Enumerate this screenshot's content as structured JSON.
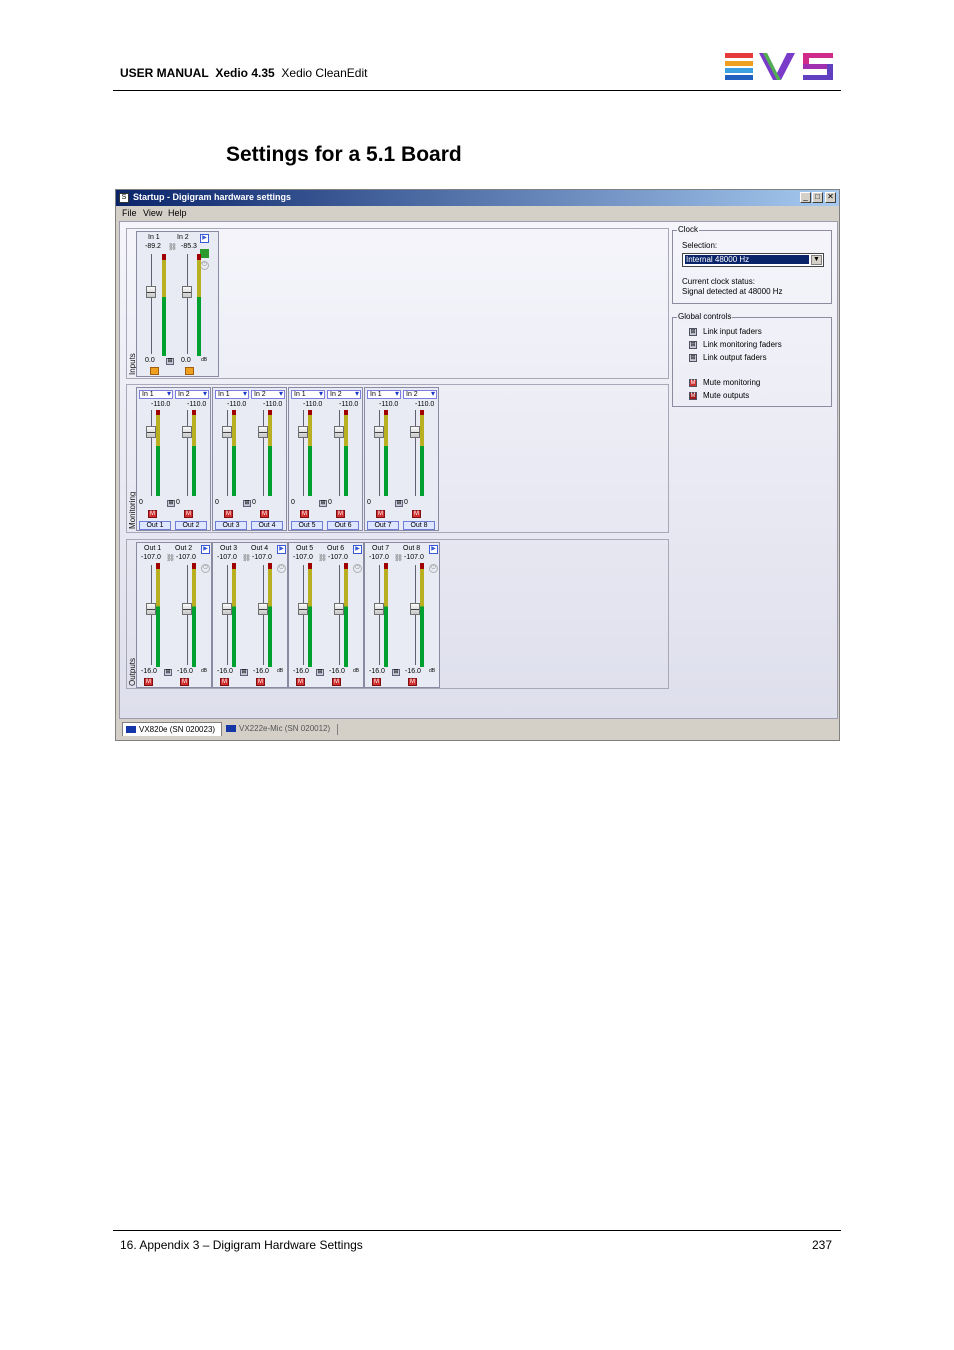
{
  "header": {
    "manual": "USER MANUAL",
    "product": "Xedio 4.35",
    "module": "Xedio CleanEdit",
    "logo_text": "EVS"
  },
  "section_title": "Settings for a 5.1 Board",
  "window": {
    "title": "Startup - Digigram hardware settings",
    "menu": [
      "File",
      "View",
      "Help"
    ],
    "groups": {
      "inputs": "Inputs",
      "monitoring": "Monitoring",
      "outputs": "Outputs"
    },
    "inputs_strip": {
      "ch1": "In 1",
      "ch2": "In 2",
      "level1": "-89.2",
      "level2": "-85.3",
      "gain1": "0.0",
      "gain2": "0.0",
      "db": "dB"
    },
    "monitoring_strips": [
      {
        "sel1": "In 1",
        "sel2": "In 2",
        "peak": "-110.0",
        "peak2": "-110.0",
        "g1": "0",
        "g2": "0",
        "out1": "Out 1",
        "out2": "Out 2"
      },
      {
        "sel1": "In 1",
        "sel2": "In 2",
        "peak": "-110.0",
        "peak2": "-110.0",
        "g1": "0",
        "g2": "0",
        "out1": "Out 3",
        "out2": "Out 4"
      },
      {
        "sel1": "In 1",
        "sel2": "In 2",
        "peak": "-110.0",
        "peak2": "-110.0",
        "g1": "0",
        "g2": "0",
        "out1": "Out 5",
        "out2": "Out 6"
      },
      {
        "sel1": "In 1",
        "sel2": "In 2",
        "peak": "-110.0",
        "peak2": "-110.0",
        "g1": "0",
        "g2": "0",
        "out1": "Out 7",
        "out2": "Out 8"
      }
    ],
    "output_strips": [
      {
        "ch1": "Out 1",
        "ch2": "Out 2",
        "l1": "-107.0",
        "l2": "-107.0",
        "g1": "-16.0",
        "g2": "-16.0",
        "db": "dB"
      },
      {
        "ch1": "Out 3",
        "ch2": "Out 4",
        "l1": "-107.0",
        "l2": "-107.0",
        "g1": "-16.0",
        "g2": "-16.0",
        "db": "dB"
      },
      {
        "ch1": "Out 5",
        "ch2": "Out 6",
        "l1": "-107.0",
        "l2": "-107.0",
        "g1": "-16.0",
        "g2": "-16.0",
        "db": "dB"
      },
      {
        "ch1": "Out 7",
        "ch2": "Out 8",
        "l1": "-107.0",
        "l2": "-107.0",
        "g1": "-16.0",
        "g2": "-16.0",
        "db": "dB"
      }
    ],
    "clock": {
      "legend": "Clock",
      "selection_label": "Selection:",
      "selection_value": "Internal 48000 Hz",
      "status_label": "Current clock status:",
      "status_value": "Signal detected at 48000 Hz"
    },
    "global": {
      "legend": "Global controls",
      "link_input": "Link input faders",
      "link_monitoring": "Link monitoring faders",
      "link_output": "Link output faders",
      "mute_monitoring": "Mute monitoring",
      "mute_outputs": "Mute outputs"
    },
    "tabs": [
      "VX820e (SN 020023)",
      "VX222e-Mic (SN 020012)"
    ]
  },
  "footer": {
    "section": "16. Appendix 3 – Digigram Hardware Settings",
    "page": "237"
  }
}
